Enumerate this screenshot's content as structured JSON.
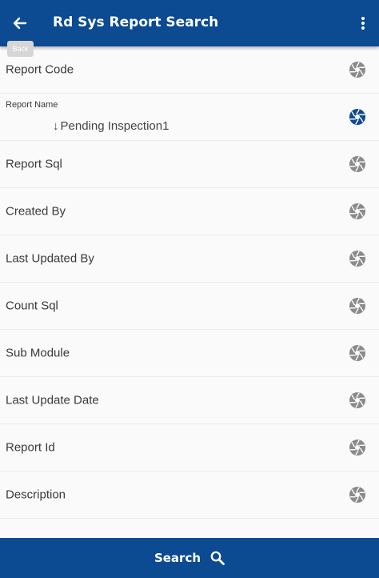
{
  "header": {
    "title": "Rd Sys Report Search",
    "back_tooltip": "Back",
    "back_icon": "arrow-left-icon",
    "menu_icon": "more-vert-icon"
  },
  "fields": [
    {
      "label": "Report Code",
      "icon": "aperture-icon"
    },
    {
      "label": "Report Name",
      "value": "Pending Inspection1",
      "sort_icon": "arrow-down-icon",
      "icon": "aperture-icon",
      "active": true
    },
    {
      "label": "Report Sql",
      "icon": "aperture-icon"
    },
    {
      "label": "Created By",
      "icon": "aperture-icon"
    },
    {
      "label": "Last Updated By",
      "icon": "aperture-icon"
    },
    {
      "label": "Count Sql",
      "icon": "aperture-icon"
    },
    {
      "label": "Sub Module",
      "icon": "aperture-icon"
    },
    {
      "label": "Last Update Date",
      "icon": "aperture-icon"
    },
    {
      "label": "Report Id",
      "icon": "aperture-icon"
    },
    {
      "label": "Description",
      "icon": "aperture-icon"
    }
  ],
  "footer": {
    "search_label": "Search",
    "search_icon": "search-icon"
  },
  "colors": {
    "primary": "#0c4a91",
    "icon_inactive": "#8a8a8a",
    "icon_active": "#0c4a91"
  }
}
